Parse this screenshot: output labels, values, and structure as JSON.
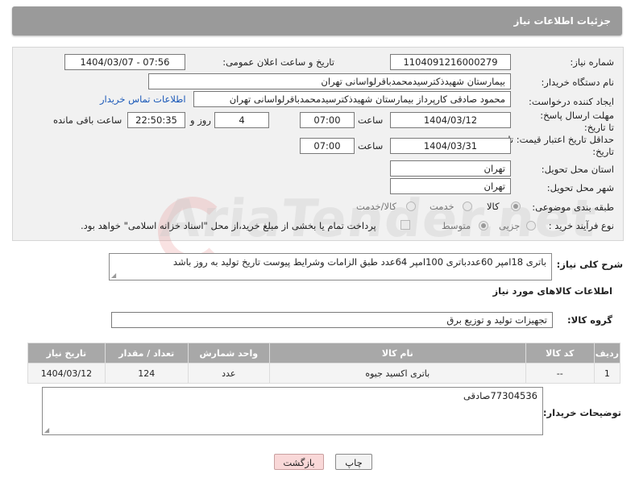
{
  "header": {
    "title": "جزئیات اطلاعات نیاز"
  },
  "fields": {
    "need_number_label": "شماره نیاز:",
    "need_number": "1104091216000279",
    "announce_label": "تاریخ و ساعت اعلان عمومی:",
    "announce_value": "1404/03/07 - 07:56",
    "buyer_org_label": "نام دستگاه خریدار:",
    "buyer_org": "بیمارستان شهیدذکترسیدمحمدباقرلواسانی تهران",
    "creator_label": "ایجاد کننده درخواست:",
    "creator": "محمود صادقی کارپرداز بیمارستان شهیدذکترسیدمحمدباقرلواسانی تهران",
    "contact_link": "اطلاعات تماس خریدار",
    "reply_deadline_label": "مهلت ارسال پاسخ: تا تاریخ:",
    "reply_date": "1404/03/12",
    "time_label": "ساعت",
    "reply_time": "07:00",
    "days_value": "4",
    "days_label": "روز و",
    "remaining_time": "22:50:35",
    "remaining_label": "ساعت باقی مانده",
    "price_validity_label": "حداقل تاریخ اعتبار قیمت: تا تاریخ:",
    "price_date": "1404/03/31",
    "price_time": "07:00",
    "province_label": "استان محل تحویل:",
    "province": "تهران",
    "city_label": "شهر محل تحویل:",
    "city": "تهران",
    "category_label": "طبقه بندی موضوعی:",
    "category_options": [
      "کالا",
      "خدمت",
      "کالا/خدمت"
    ],
    "process_label": "نوع فرآیند خرید :",
    "process_options": [
      "جزیی",
      "متوسط"
    ],
    "payment_note": "پرداخت تمام یا بخشی از مبلغ خرید،از محل \"اسناد خزانه اسلامی\" خواهد بود."
  },
  "description": {
    "label": "شرح کلی نیاز:",
    "text": "باتری 18امپر 60عددباتری 100امپر 64عدد طبق الزامات وشرایط پیوست تاریخ تولید به روز باشد"
  },
  "goods_section": {
    "title": "اطلاعات کالاهای مورد نیاز",
    "group_label": "گروه کالا:",
    "group_value": "تجهیزات تولید و توزیع برق"
  },
  "table": {
    "headers": [
      "ردیف",
      "کد کالا",
      "نام کالا",
      "واحد شمارش",
      "تعداد / مقدار",
      "تاریخ نیاز"
    ],
    "rows": [
      [
        "1",
        "--",
        "باتری اکسید جیوه",
        "عدد",
        "124",
        "1404/03/12"
      ]
    ]
  },
  "buyer_notes": {
    "label": "توضیحات خریدار:",
    "text": "77304536صادقی"
  },
  "buttons": {
    "print": "چاپ",
    "back": "بازگشت"
  },
  "watermark": "AriaTender.net"
}
